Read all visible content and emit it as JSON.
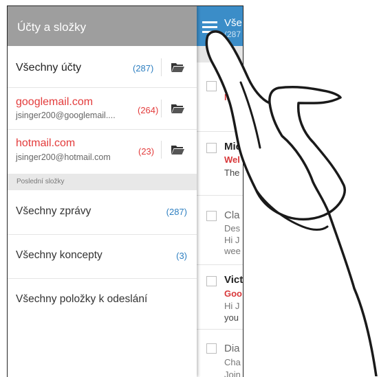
{
  "drawer": {
    "title": "Účty a složky",
    "accounts": [
      {
        "name": "Všechny účty",
        "email": "",
        "count": "(287)",
        "accent": "#222222"
      },
      {
        "name": "googlemail.com",
        "email": "jsinger200@googlemail....",
        "count": "(264)",
        "accent": "#e33b3b"
      },
      {
        "name": "hotmail.com",
        "email": "jsinger200@hotmail.com",
        "count": "(23)",
        "accent": "#e33b3b"
      }
    ],
    "section_title": "Poslední složky",
    "folders": [
      {
        "label": "Všechny zprávy",
        "count": "(287)"
      },
      {
        "label": "Všechny koncepty",
        "count": "(3)"
      },
      {
        "label": "Všechny položky k odeslání",
        "count": ""
      }
    ]
  },
  "inbox": {
    "title": "Vše",
    "count": "(287",
    "rows": [
      {
        "sender": "",
        "subject": "M",
        "line1": "",
        "line2": ""
      },
      {
        "sender": "Mic",
        "subject": "Wel",
        "line1": "The",
        "line2": ""
      },
      {
        "sender": "Cla",
        "subject": "",
        "line1": "Des",
        "line2": "Hi J",
        "line3": "wee"
      },
      {
        "sender": "Vict",
        "subject": "Goo",
        "line1": "Hi J",
        "line2": "you"
      },
      {
        "sender": "Dia",
        "subject": "",
        "line1": "Cha",
        "line2": "Join"
      }
    ]
  },
  "colors": {
    "drawer_header": "#9e9e9e",
    "inbox_header": "#3b8dc8",
    "link_blue": "#2d7fc1",
    "accent_red": "#e33b3b"
  },
  "icons": [
    "hamburger-menu-icon",
    "folder-icon",
    "pointing-hand-illustration"
  ]
}
